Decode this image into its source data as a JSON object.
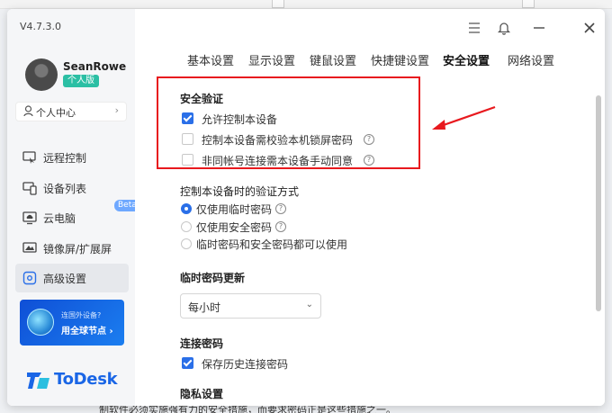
{
  "app": {
    "version": "V4.7.3.0"
  },
  "user": {
    "name": "SeanRowe",
    "plan_badge": "个人版"
  },
  "sidebar": {
    "personal_center": "个人中心",
    "items": [
      {
        "label": "远程控制",
        "icon": "remote-control-icon"
      },
      {
        "label": "设备列表",
        "icon": "device-list-icon"
      },
      {
        "label": "云电脑",
        "icon": "cloud-pc-icon",
        "badge": "Beta"
      },
      {
        "label": "镜像屏/扩展屏",
        "icon": "mirror-screen-icon"
      },
      {
        "label": "高级设置",
        "icon": "advanced-settings-icon",
        "active": true
      }
    ],
    "promo": {
      "line1": "连国外设备?",
      "line2": "用全球节点 ›"
    },
    "logo_text": "ToDesk"
  },
  "tabs": [
    {
      "label": "基本设置"
    },
    {
      "label": "显示设置"
    },
    {
      "label": "键鼠设置"
    },
    {
      "label": "快捷键设置"
    },
    {
      "label": "安全设置",
      "active": true
    },
    {
      "label": "网络设置"
    }
  ],
  "security": {
    "title": "安全验证",
    "options": [
      {
        "label": "允许控制本设备",
        "checked": true,
        "help": false
      },
      {
        "label": "控制本设备需校验本机锁屏密码",
        "checked": false,
        "help": true
      },
      {
        "label": "非同帐号连接需本设备手动同意",
        "checked": false,
        "help": true
      }
    ]
  },
  "verify_method": {
    "title": "控制本设备时的验证方式",
    "options": [
      {
        "label": "仅使用临时密码",
        "selected": true,
        "help": true
      },
      {
        "label": "仅使用安全密码",
        "selected": false,
        "help": true
      },
      {
        "label": "临时密码和安全密码都可以使用",
        "selected": false,
        "help": false
      }
    ]
  },
  "temp_password": {
    "title": "临时密码更新",
    "selected": "每小时"
  },
  "connect_password": {
    "title": "连接密码",
    "save_history_label": "保存历史连接密码",
    "save_history_checked": true
  },
  "privacy": {
    "title": "隐私设置"
  },
  "background_text": "制软件必须实施强有力的安全措施，而要求密码正是这些措施之一。",
  "colors": {
    "accent": "#2a6fe8",
    "annotation_red": "#e8191e",
    "badge_green": "#2bbfa4"
  }
}
